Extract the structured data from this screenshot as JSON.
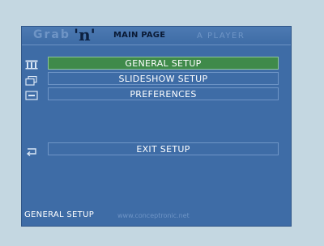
{
  "header": {
    "brand_watermark": "Grab",
    "brand_letter": "'n'",
    "page_title": "MAIN PAGE",
    "product_watermark": "A PLAYER"
  },
  "menu": {
    "items": [
      {
        "label": "GENERAL SETUP",
        "selected": true,
        "icon": "grid-icon"
      },
      {
        "label": "SLIDESHOW SETUP",
        "selected": false,
        "icon": "slideshow-icon"
      },
      {
        "label": "PREFERENCES",
        "selected": false,
        "icon": "preferences-icon"
      }
    ],
    "exit": {
      "label": "EXIT SETUP",
      "icon": "return-arrow-icon"
    }
  },
  "footer": {
    "current_section": "GENERAL SETUP",
    "watermark": "www.conceptronic.net"
  },
  "colors": {
    "panel_background": "#3e6ca6",
    "selected_row": "#3f8a4a",
    "page_background": "#c4d7e1"
  }
}
